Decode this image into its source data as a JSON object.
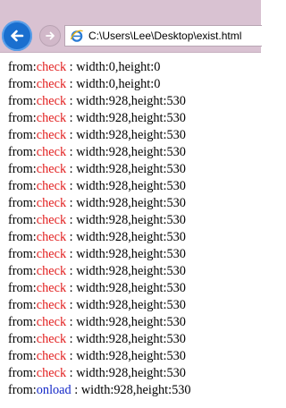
{
  "browser": {
    "url": "C:\\Users\\Lee\\Desktop\\exist.html"
  },
  "colors": {
    "check": "#e21e1e",
    "onload": "#1428c8"
  },
  "log": [
    {
      "prefix": "from:",
      "source": "check",
      "sep": " : ",
      "text": "width:0,height:0"
    },
    {
      "prefix": "from:",
      "source": "check",
      "sep": " : ",
      "text": "width:0,height:0"
    },
    {
      "prefix": "from:",
      "source": "check",
      "sep": " : ",
      "text": "width:928,height:530"
    },
    {
      "prefix": "from:",
      "source": "check",
      "sep": " : ",
      "text": "width:928,height:530"
    },
    {
      "prefix": "from:",
      "source": "check",
      "sep": " : ",
      "text": "width:928,height:530"
    },
    {
      "prefix": "from:",
      "source": "check",
      "sep": " : ",
      "text": "width:928,height:530"
    },
    {
      "prefix": "from:",
      "source": "check",
      "sep": " : ",
      "text": "width:928,height:530"
    },
    {
      "prefix": "from:",
      "source": "check",
      "sep": " : ",
      "text": "width:928,height:530"
    },
    {
      "prefix": "from:",
      "source": "check",
      "sep": " : ",
      "text": "width:928,height:530"
    },
    {
      "prefix": "from:",
      "source": "check",
      "sep": " : ",
      "text": "width:928,height:530"
    },
    {
      "prefix": "from:",
      "source": "check",
      "sep": " : ",
      "text": "width:928,height:530"
    },
    {
      "prefix": "from:",
      "source": "check",
      "sep": " : ",
      "text": "width:928,height:530"
    },
    {
      "prefix": "from:",
      "source": "check",
      "sep": " : ",
      "text": "width:928,height:530"
    },
    {
      "prefix": "from:",
      "source": "check",
      "sep": " : ",
      "text": "width:928,height:530"
    },
    {
      "prefix": "from:",
      "source": "check",
      "sep": " : ",
      "text": "width:928,height:530"
    },
    {
      "prefix": "from:",
      "source": "check",
      "sep": " : ",
      "text": "width:928,height:530"
    },
    {
      "prefix": "from:",
      "source": "check",
      "sep": " : ",
      "text": "width:928,height:530"
    },
    {
      "prefix": "from:",
      "source": "check",
      "sep": " : ",
      "text": "width:928,height:530"
    },
    {
      "prefix": "from:",
      "source": "check",
      "sep": " : ",
      "text": "width:928,height:530"
    },
    {
      "prefix": "from:",
      "source": "onload",
      "sep": " : ",
      "text": "width:928,height:530"
    }
  ]
}
